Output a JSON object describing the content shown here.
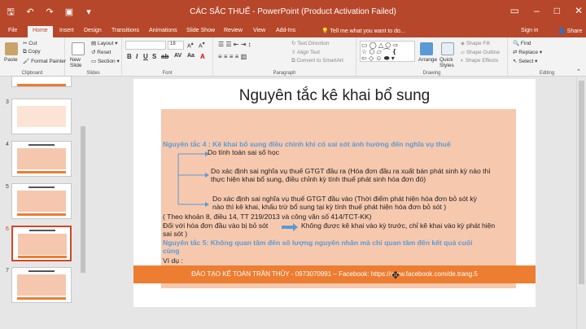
{
  "window": {
    "title": "CÁC SẮC THUẾ - PowerPoint (Product Activation Failed)",
    "user": "Sign in",
    "share": "Share"
  },
  "tabs": [
    "File",
    "Home",
    "Insert",
    "Design",
    "Transitions",
    "Animations",
    "Slide Show",
    "Review",
    "View",
    "Add-Ins"
  ],
  "tell_me": "Tell me what you want to do...",
  "ribbon": {
    "clipboard": {
      "paste": "Paste",
      "cut": "Cut",
      "copy": "Copy",
      "format_painter": "Format Painter",
      "label": "Clipboard"
    },
    "slides": {
      "new_slide": "New Slide",
      "layout": "Layout",
      "reset": "Reset",
      "section": "Section",
      "label": "Slides"
    },
    "font": {
      "name": "",
      "size": "18",
      "label": "Font"
    },
    "paragraph": {
      "text_direction": "Text Direction",
      "align_text": "Align Text",
      "convert_smartart": "Convert to SmartArt",
      "label": "Paragraph"
    },
    "drawing": {
      "arrange": "Arrange",
      "quick_styles": "Quick Styles",
      "shape_fill": "Shape Fill",
      "shape_outline": "Shape Outline",
      "shape_effects": "Shape Effects",
      "label": "Drawing"
    },
    "editing": {
      "find": "Find",
      "replace": "Replace",
      "select": "Select",
      "label": "Editing"
    }
  },
  "slide_panel": {
    "thumbnails": [
      {
        "number": "3"
      },
      {
        "number": "4"
      },
      {
        "number": "5"
      },
      {
        "number": "6"
      },
      {
        "number": "7"
      }
    ]
  },
  "slide": {
    "title": "Nguyên tắc kê khai bổ sung",
    "lines": {
      "p4": "Nguyên tắc 4 : Kê khai bổ sung điều chỉnh khi có sai sót ảnh hưởng đến nghĩa vụ thuế",
      "b1": "Do tính toán sai số học",
      "b2a": "Do xác định sai nghĩa vụ thuế GTGT đầu ra (Hóa đơn đầu ra xuất bán phát sinh kỳ nào thì",
      "b2b": "thực hiện khai bổ sung, điều chỉnh kỳ tính thuế phát sinh hóa đơn đó)",
      "b3a": "Do xác định sai nghĩa vụ thuế GTGT đầu vào (Thời điểm phát hiện hóa đơn bỏ sót kỳ",
      "b3b": "nào thì kê khai, khấu trừ bổ sung tại kỳ tính thuế phát hiện hóa đơn bỏ sót )",
      "ref": "( Theo khoản 8, điều 14, TT 219/2013 và công văn số 414/TCT-KK)",
      "input_a": "Đối với hóa đơn đầu vào bị bỏ sót",
      "input_b": "Không được kê khai vào kỳ trước, chỉ kê khai vào kỳ phát hiện",
      "input_c": "sai sót )",
      "p5a": "Nguyên tắc 5: Không quan tâm đến số lượng nguyên nhân mà chỉ quan tâm đến kết quả cuối",
      "p5b": "cùng",
      "example": "Ví dụ :"
    },
    "footer": "ĐÀO TẠO KẾ TOÁN TRẦN THỦY - 0973070991 – Facebook: https://www.facebook.com/de.trang.5"
  }
}
